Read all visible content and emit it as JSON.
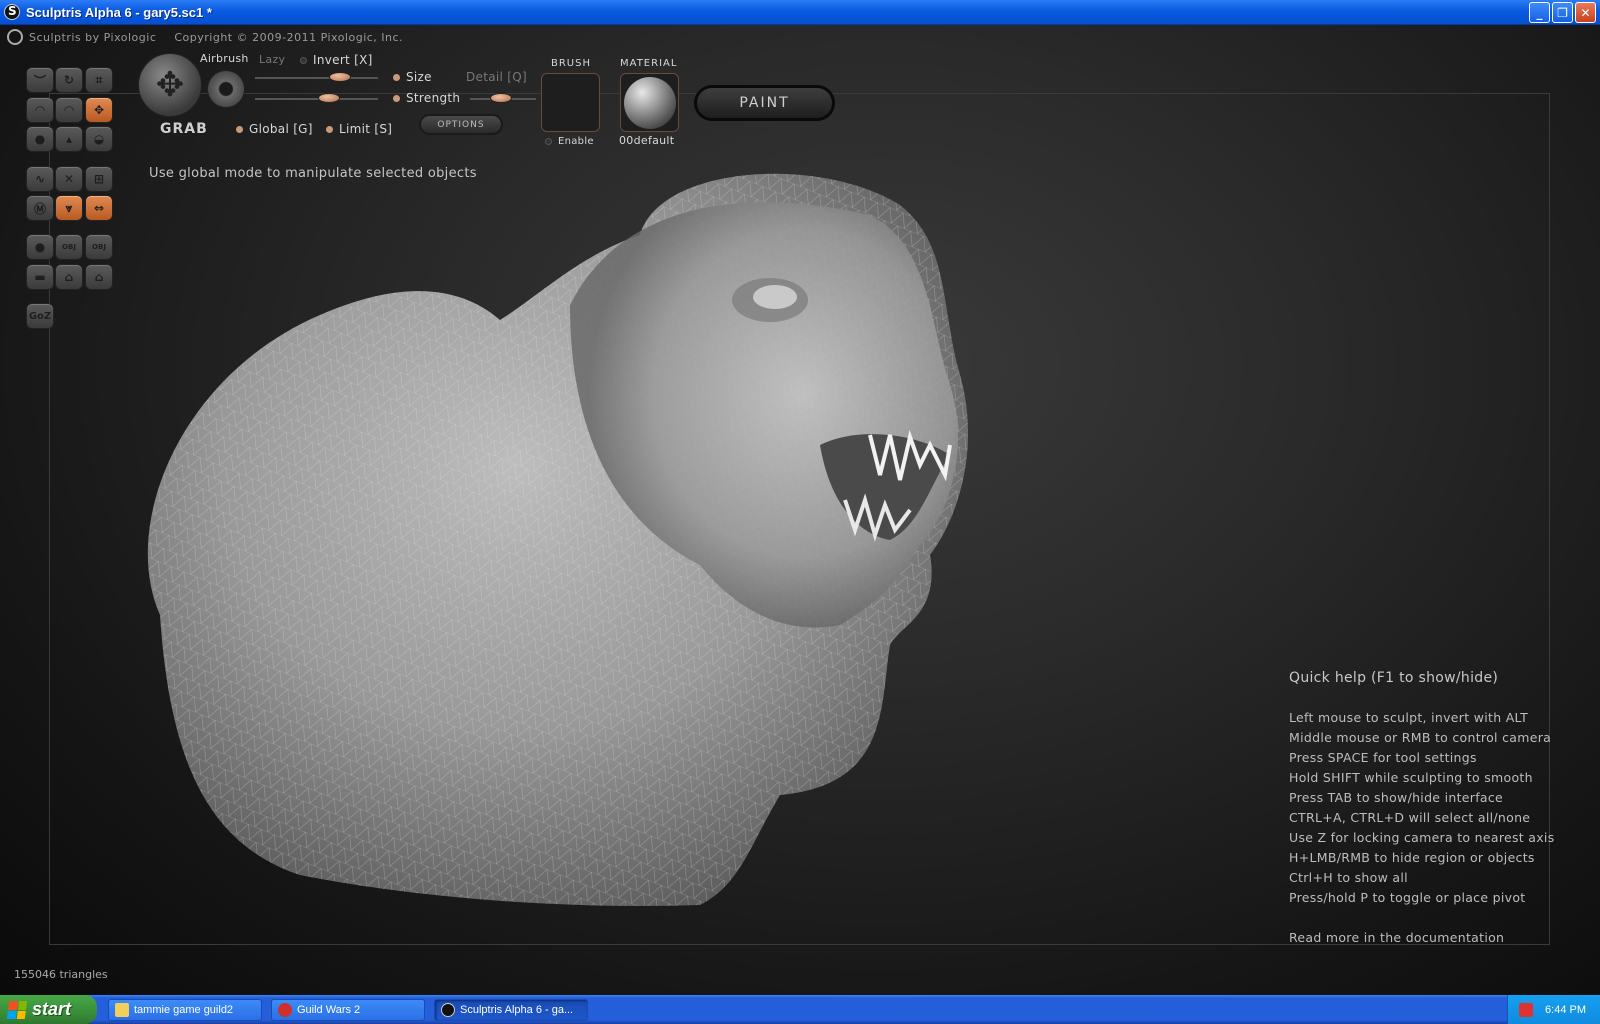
{
  "window": {
    "title": "Sculptris Alpha 6 - gary5.sc1 *",
    "buttons": {
      "minimize": "_",
      "maximize": "❐",
      "close": "✕"
    }
  },
  "brandbar": {
    "product": "Sculptris by Pixologic",
    "copyright": "Copyright © 2009-2011 Pixologic, Inc."
  },
  "tool": {
    "name": "GRAB",
    "airbrush": "Airbrush",
    "lazy": "Lazy",
    "invert": "Invert [X]",
    "size": "Size",
    "strength": "Strength",
    "detail": "Detail [Q]",
    "global": "Global [G]",
    "limit": "Limit [S]",
    "options": "OPTIONS"
  },
  "brush": {
    "label": "BRUSH",
    "enable": "Enable"
  },
  "material": {
    "label": "MATERIAL",
    "name": "00default"
  },
  "paint_button": "PAINT",
  "hint": "Use global mode to manipulate selected objects",
  "palette": {
    "goz": "GoZ",
    "obj1": "OBJ",
    "obj2": "OBJ"
  },
  "quickhelp": {
    "title": "Quick help (F1 to show/hide)",
    "lines": [
      "Left mouse to sculpt, invert with ALT",
      "Middle mouse or RMB to control camera",
      "Press SPACE for tool settings",
      "Hold SHIFT while sculpting to smooth",
      "Press TAB to show/hide interface",
      "CTRL+A, CTRL+D will select all/none",
      "Use Z for locking camera to nearest axis",
      "H+LMB/RMB to hide region or objects",
      "Ctrl+H to show all",
      "Press/hold P to toggle or place pivot"
    ],
    "more": "Read more in the documentation"
  },
  "status": {
    "triangles": "155046 triangles"
  },
  "taskbar": {
    "start": "start",
    "tasks": [
      {
        "label": "tammie game guild2",
        "icon": "folder-icon"
      },
      {
        "label": "Guild Wars 2",
        "icon": "guildwars-icon"
      },
      {
        "label": "Sculptris Alpha 6 - ga...",
        "icon": "sculptris-icon"
      }
    ],
    "clock": "6:44 PM"
  },
  "colors": {
    "accent": "#c8692e",
    "background": "#2a2a2a",
    "xp_blue": "#245edb"
  }
}
